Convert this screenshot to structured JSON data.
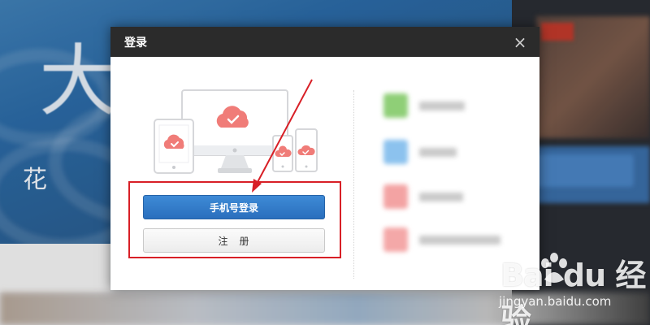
{
  "background": {
    "large_char": "大",
    "small_char": "花"
  },
  "dialog": {
    "title": "登录",
    "close_symbol": "×",
    "phone_login_label": "手机号登录",
    "register_label": "注　册",
    "social_rows": [
      {
        "icon_color": "#8fcf77"
      },
      {
        "icon_color": "#8cc2ee"
      },
      {
        "icon_color": "#f3a3a3"
      },
      {
        "icon_color": "#f4a8a8"
      }
    ]
  },
  "annotation": {
    "highlight_color": "#d81f26"
  },
  "watermark": {
    "brand": "Bai du 经验",
    "url": "jingyan.baidu.com"
  }
}
